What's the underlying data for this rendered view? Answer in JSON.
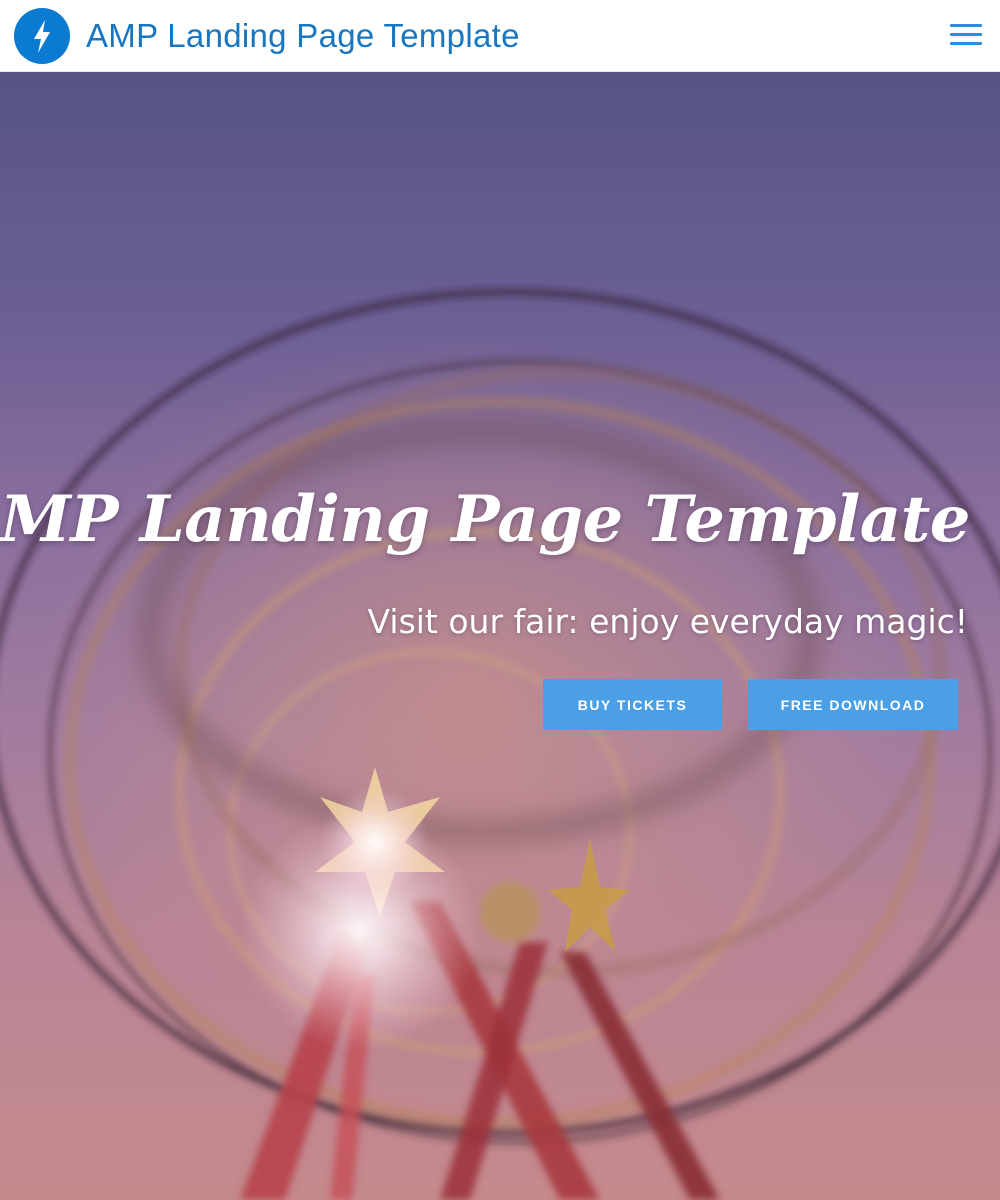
{
  "header": {
    "brand_title": "AMP Landing Page Template",
    "logo_icon": "lightning-bolt-icon",
    "menu_icon": "hamburger-menu-icon",
    "brand_color": "#1976c0",
    "logo_color": "#0b7bd1"
  },
  "hero": {
    "title": "AMP Landing Page Template",
    "subtitle": "Visit our fair: enjoy everyday magic!",
    "background_image": "ferris-wheel-photo",
    "buttons": [
      {
        "label": "BUY TICKETS"
      },
      {
        "label": "FREE DOWNLOAD"
      }
    ],
    "button_color": "#4a9fe5"
  }
}
